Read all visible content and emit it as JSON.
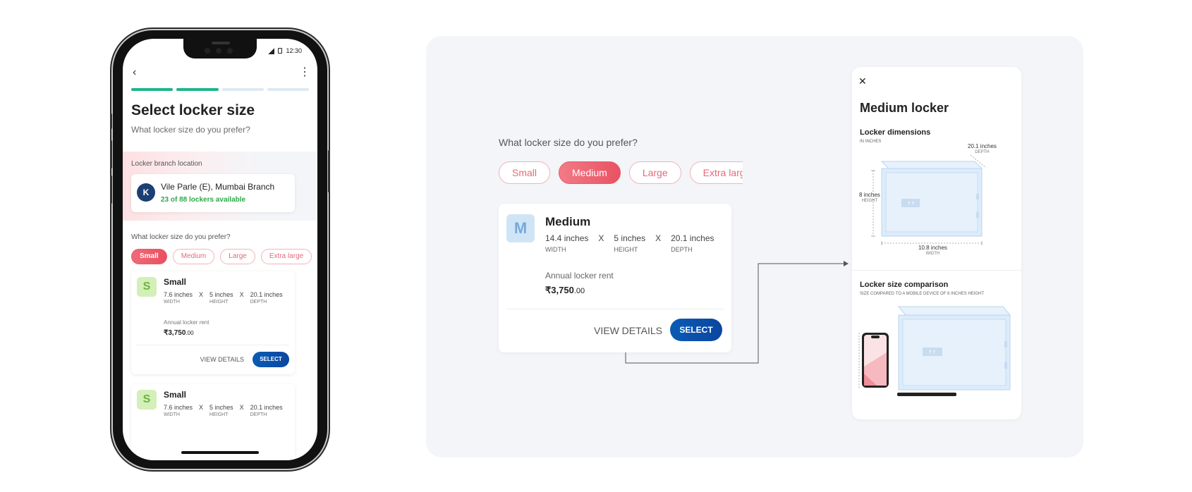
{
  "phone": {
    "status": {
      "time": "12:30"
    },
    "header": {
      "title": "Select locker size",
      "subtitle": "What locker size do you prefer?"
    },
    "branch": {
      "label": "Locker branch location",
      "name": "Vile Parle (E), Mumbai Branch",
      "availability": "23 of 88 lockers available",
      "logo_letter": "K"
    },
    "size_question": "What locker size do you prefer?",
    "chips": [
      "Small",
      "Medium",
      "Large",
      "Extra large"
    ],
    "selected_chip": "Small",
    "cards": [
      {
        "badge": "S",
        "name": "Small",
        "width": "7.6 inches",
        "width_label": "WIDTH",
        "height": "5 inches",
        "height_label": "HEIGHT",
        "depth": "20.1 inches",
        "depth_label": "DEPTH",
        "x1": "X",
        "x2": "X",
        "rent_label": "Annual locker rent",
        "rent": "₹3,750",
        "rent_decimal": ".00",
        "view": "VIEW DETAILS",
        "select": "SELECT"
      },
      {
        "badge": "S",
        "name": "Small",
        "width": "7.6 inches",
        "width_label": "WIDTH",
        "height": "5 inches",
        "height_label": "HEIGHT",
        "depth": "20.1 inches",
        "depth_label": "DEPTH",
        "x1": "X",
        "x2": "X"
      }
    ]
  },
  "detail": {
    "question": "What locker size do you prefer?",
    "chips": [
      "Small",
      "Medium",
      "Large",
      "Extra large"
    ],
    "selected_chip": "Medium",
    "card": {
      "badge": "M",
      "name": "Medium",
      "width": "14.4 inches",
      "width_label": "WIDTH",
      "height": "5 inches",
      "height_label": "HEIGHT",
      "depth": "20.1 inches",
      "depth_label": "DEPTH",
      "x1": "X",
      "x2": "X",
      "rent_label": "Annual locker rent",
      "rent": "₹3,750",
      "rent_decimal": ".00",
      "view": "VIEW DETAILS",
      "select": "SELECT"
    }
  },
  "sheet": {
    "title": "Medium locker",
    "dimensions_heading": "Locker dimensions",
    "dimensions_sub": "IN INCHES",
    "depth_value": "20.1 inches",
    "depth_unit": "DEPTH",
    "height_value": "8 inches",
    "height_unit": "HEIGHT",
    "width_value": "10.8 inches",
    "width_unit": "WIDTH",
    "comparison_heading": "Locker size comparison",
    "comparison_sub": "SIZE COMPARED TO A MOBILE DEVICE OF 6 INCHES HEIGHT"
  },
  "colors": {
    "progress_active": "#1db58a",
    "chip_active": "#ea5a68",
    "select_button": "#0a52ad",
    "availability": "#2fa84a",
    "locker_fill": "#dcecfb"
  }
}
